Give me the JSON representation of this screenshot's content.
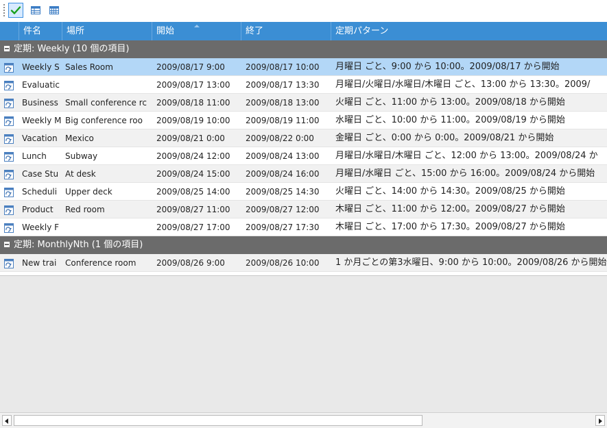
{
  "toolbar": {
    "buttons": [
      {
        "icon": "checkmark-icon",
        "active": true
      },
      {
        "icon": "table-view-icon"
      },
      {
        "icon": "calendar-view-icon"
      }
    ]
  },
  "columns": [
    "件名",
    "場所",
    "開始",
    "終了",
    "定期パターン"
  ],
  "groups": [
    {
      "label": "定期: Weekly (10 個の項目)",
      "rows": [
        {
          "subject": "Weekly S",
          "location": "Sales Room",
          "start": "2009/08/17 9:00",
          "end": "2009/08/17 10:00",
          "pattern": "月曜日 ごと、9:00 から 10:00。2009/08/17 から開始"
        },
        {
          "subject": "Evaluatic",
          "location": "",
          "start": "2009/08/17 13:00",
          "end": "2009/08/17 13:30",
          "pattern": "月曜日/火曜日/水曜日/木曜日 ごと、13:00 から 13:30。2009/"
        },
        {
          "subject": "Business",
          "location": "Small conference rc",
          "start": "2009/08/18 11:00",
          "end": "2009/08/18 13:00",
          "pattern": "火曜日 ごと、11:00 から 13:00。2009/08/18 から開始"
        },
        {
          "subject": "Weekly M",
          "location": "Big conference roo",
          "start": "2009/08/19 10:00",
          "end": "2009/08/19 11:00",
          "pattern": "水曜日 ごと、10:00 から 11:00。2009/08/19 から開始"
        },
        {
          "subject": "Vacation",
          "location": "Mexico",
          "start": "2009/08/21 0:00",
          "end": "2009/08/22 0:00",
          "pattern": "金曜日 ごと、0:00 から 0:00。2009/08/21 から開始"
        },
        {
          "subject": "Lunch",
          "location": "Subway",
          "start": "2009/08/24 12:00",
          "end": "2009/08/24 13:00",
          "pattern": "月曜日/水曜日/木曜日 ごと、12:00 から 13:00。2009/08/24 か"
        },
        {
          "subject": "Case Stu",
          "location": "At desk",
          "start": "2009/08/24 15:00",
          "end": "2009/08/24 16:00",
          "pattern": "月曜日/水曜日 ごと、15:00 から 16:00。2009/08/24 から開始"
        },
        {
          "subject": "Scheduli",
          "location": "Upper deck",
          "start": "2009/08/25 14:00",
          "end": "2009/08/25 14:30",
          "pattern": "火曜日 ごと、14:00 から 14:30。2009/08/25 から開始"
        },
        {
          "subject": "Product",
          "location": "Red room",
          "start": "2009/08/27 11:00",
          "end": "2009/08/27 12:00",
          "pattern": "木曜日 ごと、11:00 から 12:00。2009/08/27 から開始"
        },
        {
          "subject": "Weekly F",
          "location": "",
          "start": "2009/08/27 17:00",
          "end": "2009/08/27 17:30",
          "pattern": "木曜日 ごと、17:00 から 17:30。2009/08/27 から開始"
        }
      ]
    },
    {
      "label": "定期: MonthlyNth (1 個の項目)",
      "rows": [
        {
          "subject": "New trai",
          "location": "Conference room",
          "start": "2009/08/26 9:00",
          "end": "2009/08/26 10:00",
          "pattern": "1 か月ごとの第3水曜日、9:00 から 10:00。2009/08/26 から開始"
        }
      ]
    }
  ],
  "colors": {
    "header": "#3b8ed4",
    "group": "#6b6b6b",
    "selected": "#b3d7f7"
  }
}
